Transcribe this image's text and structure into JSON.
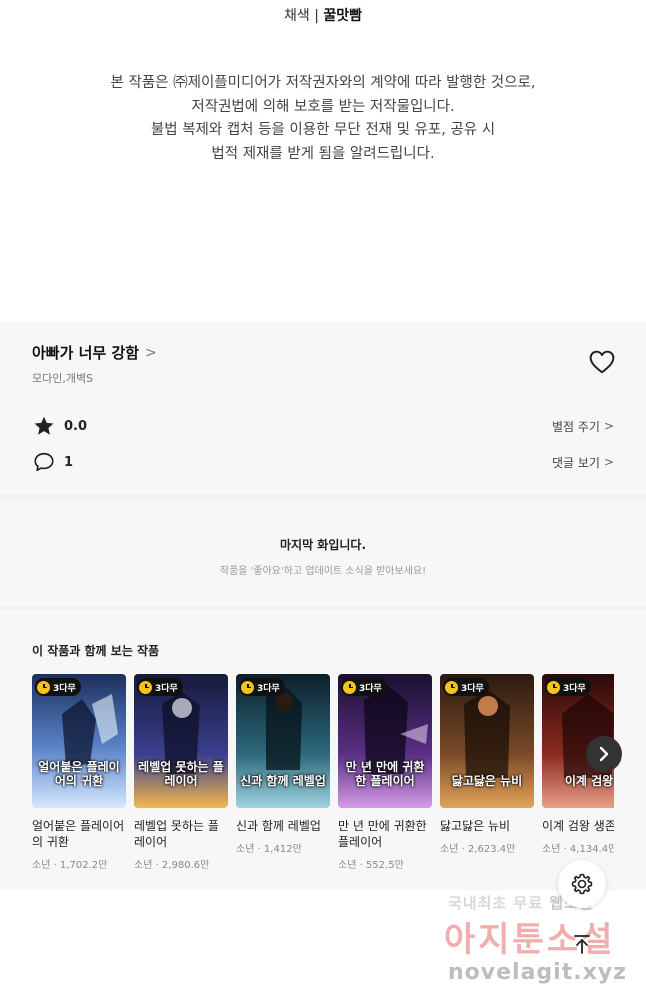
{
  "credits": {
    "label": "채색",
    "name": "꿀맛빰"
  },
  "notice": {
    "lines": [
      "본 작품은 ㈜제이플미디어가 저작권자와의 계약에 따라 발행한 것으로,",
      "저작권법에 의해 보호를 받는 저작물입니다.",
      "불법 복제와 캡처 등을 이용한 무단 전재 및 유포, 공유 시",
      "법적 제재를 받게 됨을 알려드립니다."
    ]
  },
  "series": {
    "title": "아빠가 너무 강함",
    "chevron": ">",
    "author": "모다인,개벽S",
    "rating_value": "0.0",
    "rating_action": "별점 주기",
    "comment_count": "1",
    "comment_action": "댓글 보기",
    "icons": [
      "heart-icon",
      "star-icon",
      "comment-icon",
      "chevron-right-icon"
    ]
  },
  "last_episode": {
    "title": "마지막 화입니다.",
    "subtitle": "작품을 '좋아요'하고 업데이트 소식을 받아보세요!"
  },
  "recommendations": {
    "heading": "이 작품과 함께 보는 작품",
    "badge": "3다무",
    "items": [
      {
        "name": "얼어붙은 플레이어의 귀환",
        "cover_text": "얼어붙은 플레이어의 귀환",
        "meta": "소년 · 1,702.2만",
        "colors": [
          "#1d2f5c",
          "#5a84c9",
          "#d6e8ff"
        ]
      },
      {
        "name": "레벨업 못하는 플레이어",
        "cover_text": "레벨업 못하는 플레이어",
        "meta": "소년 · 2,980.6만",
        "colors": [
          "#161a3a",
          "#3a3f8f",
          "#f3b84d"
        ]
      },
      {
        "name": "신과 함께 레벨업",
        "cover_text": "신과 함께 레벨업",
        "meta": "소년 · 1,412만",
        "colors": [
          "#0d1e2a",
          "#2d6a7c",
          "#9fd3e0"
        ]
      },
      {
        "name": "만 년 만에 귀환한 플레이어",
        "cover_text": "만 년 만에 귀환한 플레이어",
        "meta": "소년 · 552.5만",
        "colors": [
          "#1a1030",
          "#5b2f85",
          "#d59be8"
        ]
      },
      {
        "name": "닳고닳은 뉴비",
        "cover_text": "닳고닳은 뉴비",
        "meta": "소년 · 2,623.4만",
        "colors": [
          "#2b1a10",
          "#7b4a28",
          "#e3a45a"
        ]
      },
      {
        "name": "이계 검왕 생존기",
        "cover_text": "이계 검왕",
        "meta": "소년 · 4,134.4만",
        "colors": [
          "#2a0a0a",
          "#8c2a1f",
          "#e8a088"
        ]
      }
    ]
  },
  "floating": {
    "settings_icon": "gear-icon",
    "top_icon": "arrow-up-icon",
    "next_icon": "chevron-right-icon"
  },
  "watermark": {
    "line1_a": "국내최초 무료",
    "line1_b": "웹소설",
    "line2": "아지툰소설",
    "line3": "novelagit.xyz"
  }
}
